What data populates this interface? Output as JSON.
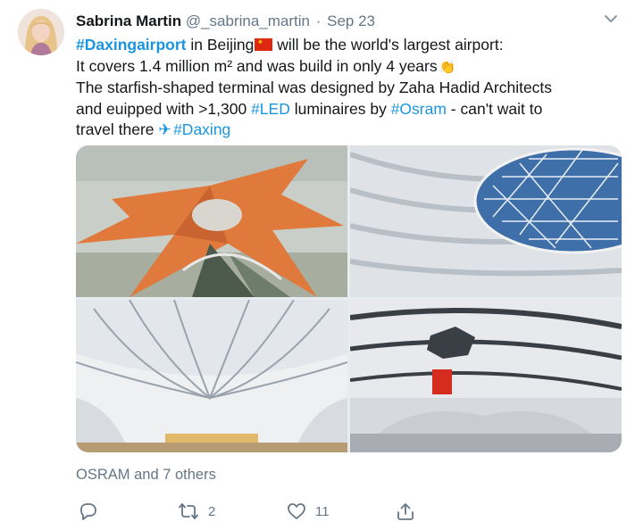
{
  "tweet": {
    "author_name": "Sabrina Martin",
    "handle": "@_sabrina_martin",
    "separator": "·",
    "date": "Sep 23",
    "line1": {
      "hashtag": "#Daxingairport",
      "text": " in Beijing",
      "rest": " will be the world's largest airport:"
    },
    "line2": "It covers 1.4 million m² and was build in only 4 years",
    "line3": "The starfish-shaped terminal was designed by Zaha Hadid Architects",
    "line4": {
      "pre": "and euipped with >1,300 ",
      "hashtag1": "#LED",
      "mid": " luminaires by ",
      "hashtag2": "#Osram",
      "post": " - can't wait to"
    },
    "line5": {
      "pre": "travel there ",
      "hashtag": "#Daxing"
    },
    "emoji": {
      "flag": "china-flag-icon",
      "clap": "clapping-hands-icon",
      "plane": "airplane-icon"
    },
    "likers": "OSRAM and 7 others",
    "actions": {
      "reply_count": "",
      "retweet_count": "2",
      "like_count": "11"
    },
    "colors": {
      "link": "#1b95e0",
      "secondary": "#657786",
      "text": "#14171a"
    }
  }
}
